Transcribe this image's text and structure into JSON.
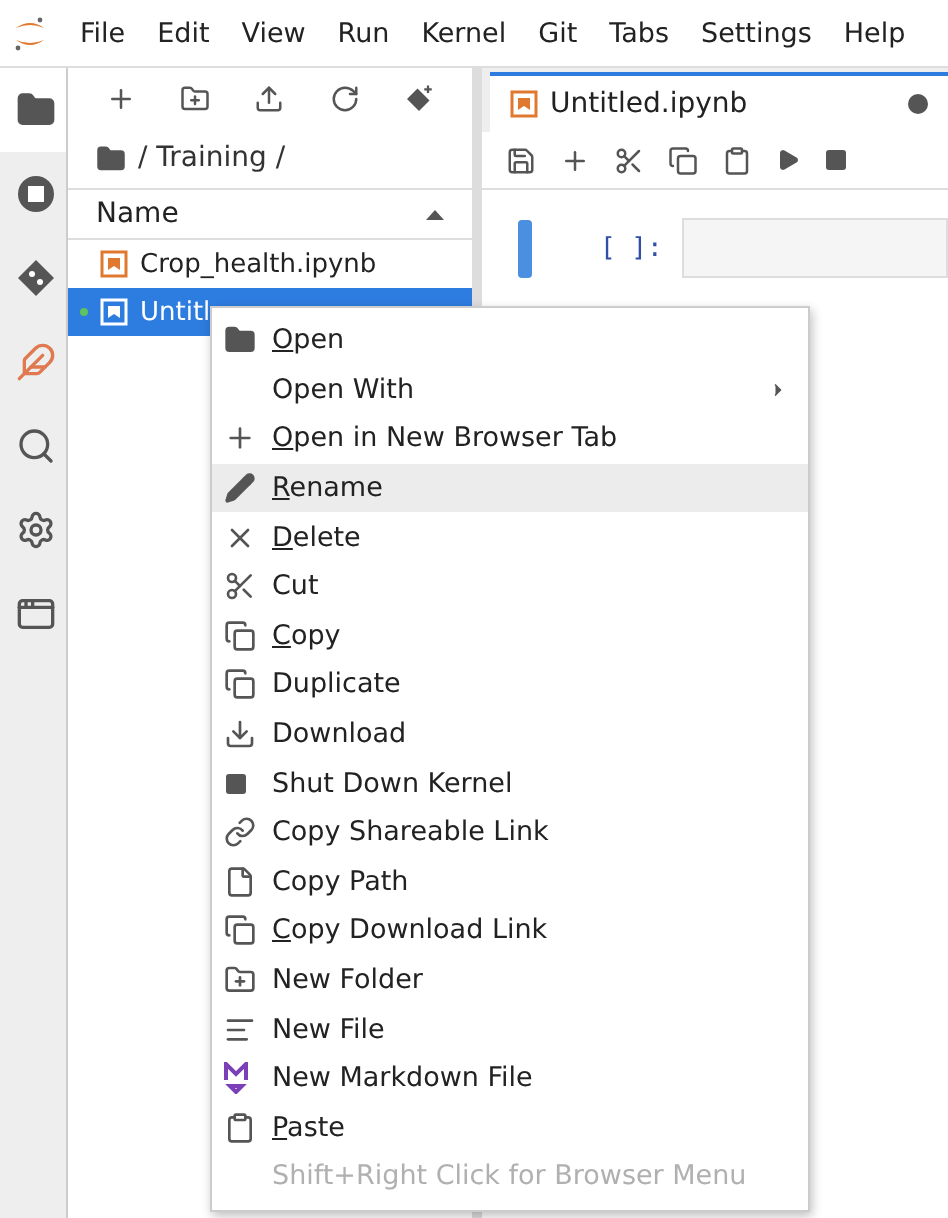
{
  "menubar": {
    "items": [
      "File",
      "Edit",
      "View",
      "Run",
      "Kernel",
      "Git",
      "Tabs",
      "Settings",
      "Help"
    ]
  },
  "activity_bar": {
    "items": [
      {
        "selected": true
      },
      {
        "selected": false
      },
      {
        "selected": false
      },
      {
        "selected": false
      },
      {
        "selected": false
      },
      {
        "selected": false
      },
      {
        "selected": false
      }
    ]
  },
  "file_browser": {
    "breadcrumb": "/ Training /",
    "column": "Name",
    "files": [
      {
        "name": "Crop_health.ipynb",
        "selected": false,
        "running": false
      },
      {
        "name": "Untitl",
        "selected": true,
        "running": true
      }
    ]
  },
  "notebook": {
    "tab": {
      "title": "Untitled.ipynb",
      "dirty": true
    },
    "cell": {
      "prompt": "[ ]:"
    }
  },
  "context_menu": {
    "items": [
      {
        "kind": "item",
        "label": "Open",
        "mnemonic": true,
        "highlighted": false,
        "submenu": false
      },
      {
        "kind": "item",
        "label": "Open With",
        "mnemonic": false,
        "highlighted": false,
        "submenu": true
      },
      {
        "kind": "item",
        "label": "Open in New Browser Tab",
        "mnemonic": true,
        "highlighted": false,
        "submenu": false
      },
      {
        "kind": "item",
        "label": "Rename",
        "mnemonic": true,
        "highlighted": true,
        "submenu": false
      },
      {
        "kind": "item",
        "label": "Delete",
        "mnemonic": true,
        "highlighted": false,
        "submenu": false
      },
      {
        "kind": "item",
        "label": "Cut",
        "mnemonic": false,
        "highlighted": false,
        "submenu": false
      },
      {
        "kind": "item",
        "label": "Copy",
        "mnemonic": true,
        "highlighted": false,
        "submenu": false
      },
      {
        "kind": "item",
        "label": "Duplicate",
        "mnemonic": false,
        "highlighted": false,
        "submenu": false
      },
      {
        "kind": "item",
        "label": "Download",
        "mnemonic": false,
        "highlighted": false,
        "submenu": false
      },
      {
        "kind": "item",
        "label": "Shut Down Kernel",
        "mnemonic": false,
        "highlighted": false,
        "submenu": false
      },
      {
        "kind": "item",
        "label": "Copy Shareable Link",
        "mnemonic": false,
        "highlighted": false,
        "submenu": false
      },
      {
        "kind": "item",
        "label": "Copy Path",
        "mnemonic": false,
        "highlighted": false,
        "submenu": false
      },
      {
        "kind": "item",
        "label": "Copy Download Link",
        "mnemonic": true,
        "highlighted": false,
        "submenu": false
      },
      {
        "kind": "item",
        "label": "New Folder",
        "mnemonic": false,
        "highlighted": false,
        "submenu": false
      },
      {
        "kind": "item",
        "label": "New File",
        "mnemonic": false,
        "highlighted": false,
        "submenu": false
      },
      {
        "kind": "item",
        "label": "New Markdown File",
        "mnemonic": false,
        "highlighted": false,
        "submenu": false
      },
      {
        "kind": "item",
        "label": "Paste",
        "mnemonic": true,
        "highlighted": false,
        "submenu": false
      },
      {
        "kind": "hint",
        "label": "Shift+Right Click for Browser Menu",
        "mnemonic": false,
        "highlighted": false,
        "submenu": false
      }
    ]
  }
}
